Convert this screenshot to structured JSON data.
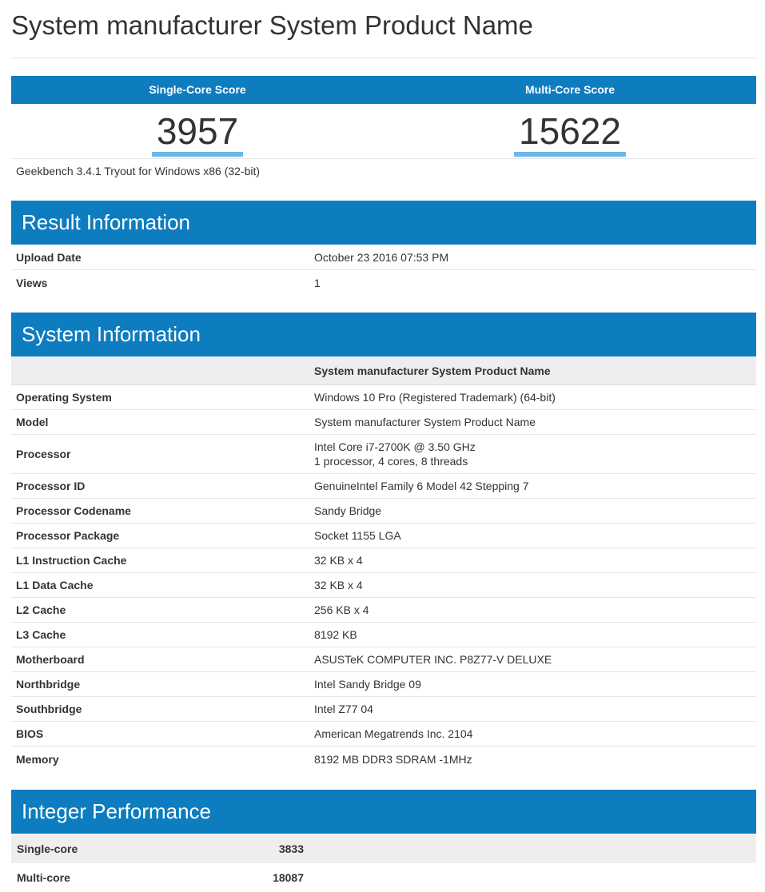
{
  "page_title": "System manufacturer System Product Name",
  "scores": {
    "single_label": "Single-Core Score",
    "single_value": "3957",
    "multi_label": "Multi-Core Score",
    "multi_value": "15622"
  },
  "version": "Geekbench 3.4.1 Tryout for Windows x86 (32-bit)",
  "result_info": {
    "title": "Result Information",
    "rows": [
      {
        "key": "Upload Date",
        "value": "October 23 2016 07:53 PM"
      },
      {
        "key": "Views",
        "value": "1"
      }
    ]
  },
  "system_info": {
    "title": "System Information",
    "header_value": "System manufacturer System Product Name",
    "rows": [
      {
        "key": "Operating System",
        "value": "Windows 10 Pro (Registered Trademark) (64-bit)"
      },
      {
        "key": "Model",
        "value": "System manufacturer System Product Name"
      },
      {
        "key": "Processor",
        "value": "Intel Core i7-2700K @ 3.50 GHz",
        "value2": "1 processor, 4 cores, 8 threads"
      },
      {
        "key": "Processor ID",
        "value": "GenuineIntel Family 6 Model 42 Stepping 7"
      },
      {
        "key": "Processor Codename",
        "value": "Sandy Bridge"
      },
      {
        "key": "Processor Package",
        "value": "Socket 1155 LGA"
      },
      {
        "key": "L1 Instruction Cache",
        "value": "32 KB x 4"
      },
      {
        "key": "L1 Data Cache",
        "value": "32 KB x 4"
      },
      {
        "key": "L2 Cache",
        "value": "256 KB x 4"
      },
      {
        "key": "L3 Cache",
        "value": "8192 KB"
      },
      {
        "key": "Motherboard",
        "value": "ASUSTeK COMPUTER INC. P8Z77-V DELUXE"
      },
      {
        "key": "Northbridge",
        "value": "Intel Sandy Bridge 09"
      },
      {
        "key": "Southbridge",
        "value": "Intel Z77 04"
      },
      {
        "key": "BIOS",
        "value": "American Megatrends Inc. 2104"
      },
      {
        "key": "Memory",
        "value": "8192 MB DDR3 SDRAM -1MHz"
      }
    ]
  },
  "integer_perf": {
    "title": "Integer Performance",
    "rows": [
      {
        "key": "Single-core",
        "value": "3833"
      },
      {
        "key": "Multi-core",
        "value": "18087"
      }
    ]
  },
  "colors": {
    "header_blue": "#0d7dc0",
    "score_underline": "#6ab8ea",
    "stripe_gray": "#eeeeee"
  }
}
